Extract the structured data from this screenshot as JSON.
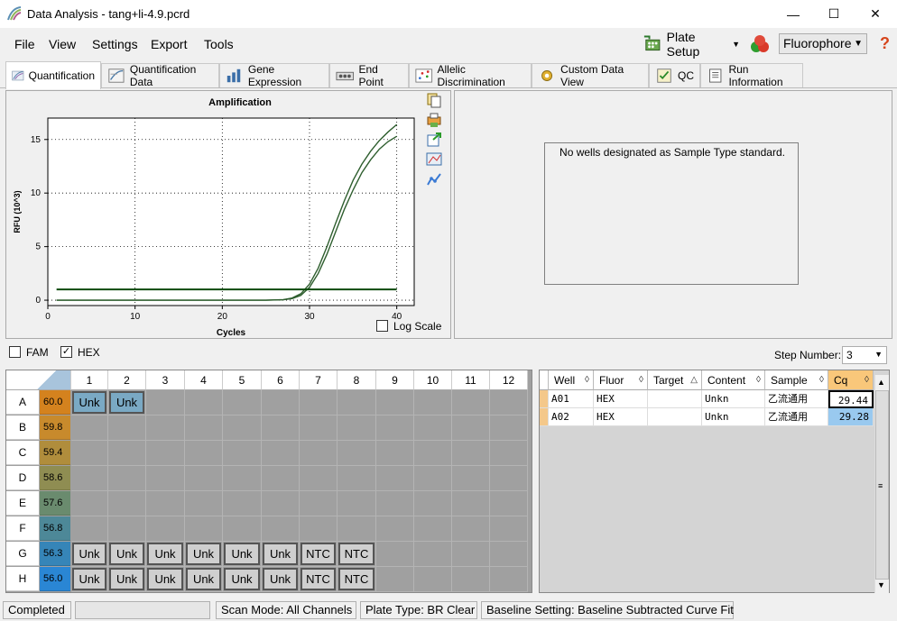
{
  "window": {
    "title": "Data Analysis - tang+li-4.9.pcrd",
    "minimize": "—",
    "maximize": "☐",
    "close": "✕"
  },
  "menu": {
    "file": "File",
    "view": "View",
    "settings": "Settings",
    "export": "Export",
    "tools": "Tools"
  },
  "toolbar": {
    "plate_setup": "Plate Setup",
    "fluorophore": "Fluorophore",
    "help": "?"
  },
  "tabs": [
    {
      "label": "Quantification"
    },
    {
      "label": "Quantification Data"
    },
    {
      "label": "Gene Expression"
    },
    {
      "label": "End Point"
    },
    {
      "label": "Allelic Discrimination"
    },
    {
      "label": "Custom Data View"
    },
    {
      "label": "QC"
    },
    {
      "label": "Run Information"
    }
  ],
  "standard_curve": {
    "message": "No wells designated as Sample Type standard."
  },
  "channels": {
    "fam": {
      "label": "FAM",
      "checked": false
    },
    "hex": {
      "label": "HEX",
      "checked": true
    }
  },
  "step": {
    "label": "Step Number:",
    "value": "3"
  },
  "log_scale": {
    "label": "Log Scale",
    "checked": false
  },
  "chart_data": {
    "type": "line",
    "title": "Amplification",
    "xlabel": "Cycles",
    "ylabel": "RFU (10^3)",
    "xlim": [
      0,
      42
    ],
    "ylim": [
      -0.5,
      17
    ],
    "xticks": [
      0,
      10,
      20,
      30,
      40
    ],
    "yticks": [
      0,
      5,
      10,
      15
    ],
    "grid": true,
    "threshold": 1.0,
    "series": [
      {
        "x": [
          1,
          5,
          10,
          15,
          20,
          25,
          27,
          28,
          29,
          30,
          31,
          32,
          33,
          34,
          35,
          36,
          37,
          38,
          39,
          40
        ],
        "values": [
          0,
          0,
          0,
          0,
          0,
          0,
          0.05,
          0.2,
          0.6,
          1.5,
          3.0,
          5.0,
          7.2,
          9.3,
          11.2,
          12.7,
          13.9,
          14.9,
          15.7,
          16.4
        ],
        "color": "#2e5e2e"
      },
      {
        "x": [
          1,
          5,
          10,
          15,
          20,
          25,
          27,
          28,
          29,
          30,
          31,
          32,
          33,
          34,
          35,
          36,
          37,
          38,
          39,
          40
        ],
        "values": [
          0,
          0,
          0,
          0,
          0,
          0,
          0.04,
          0.15,
          0.45,
          1.2,
          2.5,
          4.3,
          6.4,
          8.5,
          10.3,
          11.9,
          13.1,
          14.1,
          14.8,
          15.3
        ],
        "color": "#2e5e2e"
      }
    ]
  },
  "plate": {
    "columns": [
      "1",
      "2",
      "3",
      "4",
      "5",
      "6",
      "7",
      "8",
      "9",
      "10",
      "11",
      "12"
    ],
    "rows": [
      {
        "label": "A",
        "temp": "60.0",
        "color": "#d4821e",
        "wells": [
          "Unk",
          "Unk",
          "",
          "",
          "",
          "",
          "",
          "",
          "",
          "",
          "",
          ""
        ],
        "selected": [
          true,
          true
        ]
      },
      {
        "label": "B",
        "temp": "59.8",
        "color": "#c88a2c",
        "wells": [
          "",
          "",
          "",
          "",
          "",
          "",
          "",
          "",
          "",
          "",
          "",
          ""
        ]
      },
      {
        "label": "C",
        "temp": "59.4",
        "color": "#b08d3c",
        "wells": [
          "",
          "",
          "",
          "",
          "",
          "",
          "",
          "",
          "",
          "",
          "",
          ""
        ]
      },
      {
        "label": "D",
        "temp": "58.6",
        "color": "#8f8d52",
        "wells": [
          "",
          "",
          "",
          "",
          "",
          "",
          "",
          "",
          "",
          "",
          "",
          ""
        ]
      },
      {
        "label": "E",
        "temp": "57.6",
        "color": "#6a8b6e",
        "wells": [
          "",
          "",
          "",
          "",
          "",
          "",
          "",
          "",
          "",
          "",
          "",
          ""
        ]
      },
      {
        "label": "F",
        "temp": "56.8",
        "color": "#4d8898",
        "wells": [
          "",
          "",
          "",
          "",
          "",
          "",
          "",
          "",
          "",
          "",
          "",
          ""
        ]
      },
      {
        "label": "G",
        "temp": "56.3",
        "color": "#3685b8",
        "wells": [
          "Unk",
          "Unk",
          "Unk",
          "Unk",
          "Unk",
          "Unk",
          "NTC",
          "NTC",
          "",
          "",
          "",
          ""
        ]
      },
      {
        "label": "H",
        "temp": "56.0",
        "color": "#2a86d4",
        "wells": [
          "Unk",
          "Unk",
          "Unk",
          "Unk",
          "Unk",
          "Unk",
          "NTC",
          "NTC",
          "",
          "",
          "",
          ""
        ]
      }
    ]
  },
  "table": {
    "headers": [
      "Well",
      "Fluor",
      "Target",
      "Content",
      "Sample",
      "Cq"
    ],
    "rows": [
      {
        "well": "A01",
        "fluor": "HEX",
        "target": "",
        "content": "Unkn",
        "sample": "乙流通用",
        "cq": "29.44"
      },
      {
        "well": "A02",
        "fluor": "HEX",
        "target": "",
        "content": "Unkn",
        "sample": "乙流通用",
        "cq": "29.28"
      }
    ]
  },
  "status": {
    "state": "Completed",
    "scan_mode": "Scan Mode: All Channels",
    "plate_type": "Plate Type: BR Clear",
    "baseline": "Baseline Setting: Baseline Subtracted Curve Fit"
  }
}
